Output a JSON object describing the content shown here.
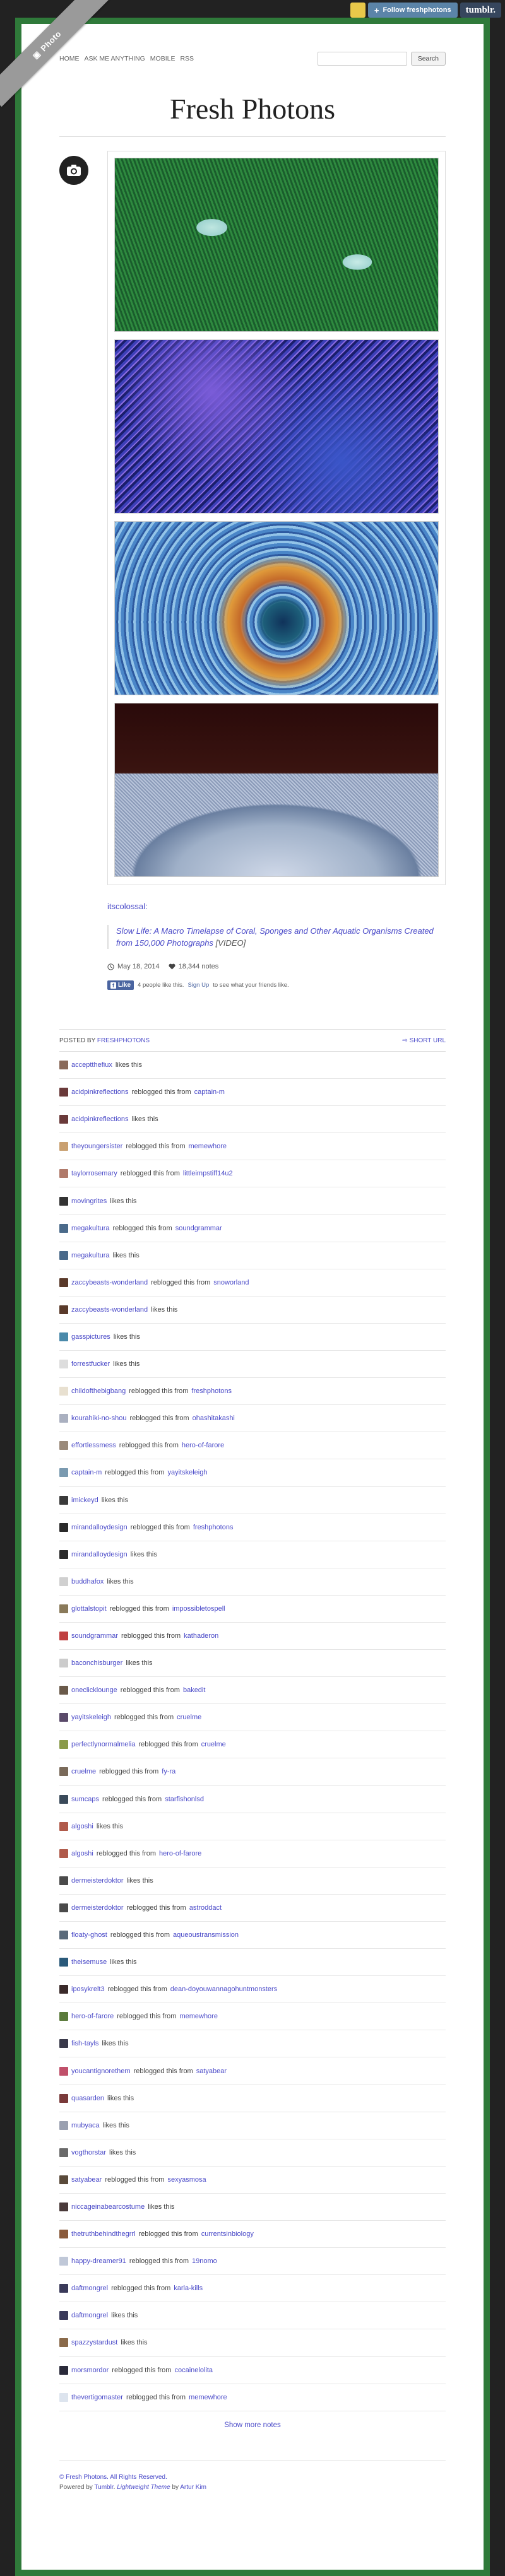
{
  "tumblr_controls": {
    "follow_label": "Follow freshphotons",
    "brand": "tumblr."
  },
  "ribbon": {
    "label": "Photo"
  },
  "nav": {
    "links": [
      "HOME",
      "ASK ME ANYTHING",
      "MOBILE",
      "RSS"
    ],
    "search_placeholder": "",
    "search_button": "Search"
  },
  "site_title": "Fresh Photons",
  "post": {
    "source": "itscolossal:",
    "quote_link": "Slow Life: A Macro Timelapse of Coral, Sponges and Other Aquatic Organisms Created from 150,000 Photographs",
    "quote_suffix": "[VIDEO]",
    "date": "May 18, 2014",
    "notes_count": "18,344 notes",
    "fb_like": "Like",
    "fb_text": "4 people like this.",
    "fb_signup": "Sign Up",
    "fb_text2": "to see what your friends like.",
    "posted_by_label": "POSTED BY",
    "posted_by_user": "FRESHPHOTONS",
    "short_url": "SHORT URL"
  },
  "notes": [
    {
      "user": "acceptthefiux",
      "action": "likes this",
      "from": "",
      "color": "#8a6a5a"
    },
    {
      "user": "acidpinkreflections",
      "action": "reblogged this from",
      "from": "captain-m",
      "color": "#6a3a3a"
    },
    {
      "user": "acidpinkreflections",
      "action": "likes this",
      "from": "",
      "color": "#6a3a3a"
    },
    {
      "user": "theyoungersister",
      "action": "reblogged this from",
      "from": "memewhore",
      "color": "#c9a070"
    },
    {
      "user": "taylorrosemary",
      "action": "reblogged this from",
      "from": "littleimpstiff14u2",
      "color": "#b07a6a"
    },
    {
      "user": "movingrites",
      "action": "likes this",
      "from": "",
      "color": "#333"
    },
    {
      "user": "megakultura",
      "action": "reblogged this from",
      "from": "soundgrammar",
      "color": "#4a6a8a"
    },
    {
      "user": "megakultura",
      "action": "likes this",
      "from": "",
      "color": "#4a6a8a"
    },
    {
      "user": "zaccybeasts-wonderland",
      "action": "reblogged this from",
      "from": "snoworland",
      "color": "#5a3a2a"
    },
    {
      "user": "zaccybeasts-wonderland",
      "action": "likes this",
      "from": "",
      "color": "#5a3a2a"
    },
    {
      "user": "gasspictures",
      "action": "likes this",
      "from": "",
      "color": "#4a8aaa"
    },
    {
      "user": "forrestfucker",
      "action": "likes this",
      "from": "",
      "color": "#ddd"
    },
    {
      "user": "childofthebigbang",
      "action": "reblogged this from",
      "from": "freshphotons",
      "color": "#e8e0d0"
    },
    {
      "user": "kourahiki-no-shou",
      "action": "reblogged this from",
      "from": "ohashitakashi",
      "color": "#aab0c0"
    },
    {
      "user": "effortlessmess",
      "action": "reblogged this from",
      "from": "hero-of-farore",
      "color": "#9a8a7a"
    },
    {
      "user": "captain-m",
      "action": "reblogged this from",
      "from": "yayitskeleigh",
      "color": "#7a9ab0"
    },
    {
      "user": "imickeyd",
      "action": "likes this",
      "from": "",
      "color": "#3a3a3a"
    },
    {
      "user": "mirandalloydesign",
      "action": "reblogged this from",
      "from": "freshphotons",
      "color": "#2a2a2a"
    },
    {
      "user": "mirandalloydesign",
      "action": "likes this",
      "from": "",
      "color": "#2a2a2a"
    },
    {
      "user": "buddhafox",
      "action": "likes this",
      "from": "",
      "color": "#d0d0d0"
    },
    {
      "user": "glottalstopit",
      "action": "reblogged this from",
      "from": "impossibletospell",
      "color": "#8a7a5a"
    },
    {
      "user": "soundgrammar",
      "action": "reblogged this from",
      "from": "kathaderon",
      "color": "#c04040"
    },
    {
      "user": "baconchisburger",
      "action": "likes this",
      "from": "",
      "color": "#ccc"
    },
    {
      "user": "oneclicklounge",
      "action": "reblogged this from",
      "from": "bakedit",
      "color": "#6a5a4a"
    },
    {
      "user": "yayitskeleigh",
      "action": "reblogged this from",
      "from": "cruelme",
      "color": "#5a4a6a"
    },
    {
      "user": "perfectlynormalmelia",
      "action": "reblogged this from",
      "from": "cruelme",
      "color": "#8a9a4a"
    },
    {
      "user": "cruelme",
      "action": "reblogged this from",
      "from": "fy-ra",
      "color": "#7a6a5a"
    },
    {
      "user": "sumcaps",
      "action": "reblogged this from",
      "from": "starfishonlsd",
      "color": "#3a4a5a"
    },
    {
      "user": "algoshi",
      "action": "likes this",
      "from": "",
      "color": "#b05a4a"
    },
    {
      "user": "algoshi",
      "action": "reblogged this from",
      "from": "hero-of-farore",
      "color": "#b05a4a"
    },
    {
      "user": "dermeisterdoktor",
      "action": "likes this",
      "from": "",
      "color": "#4a4a4a"
    },
    {
      "user": "dermeisterdoktor",
      "action": "reblogged this from",
      "from": "astroddact",
      "color": "#4a4a4a"
    },
    {
      "user": "floaty-ghost",
      "action": "reblogged this from",
      "from": "aqueoustransmission",
      "color": "#5a6a7a"
    },
    {
      "user": "theisemuse",
      "action": "likes this",
      "from": "",
      "color": "#2a5a7a"
    },
    {
      "user": "iposykrelt3",
      "action": "reblogged this from",
      "from": "dean-doyouwannagohuntmonsters",
      "color": "#3a2a2a"
    },
    {
      "user": "hero-of-farore",
      "action": "reblogged this from",
      "from": "memewhore",
      "color": "#5a7a3a"
    },
    {
      "user": "fish-tayls",
      "action": "likes this",
      "from": "",
      "color": "#3a3a4a"
    },
    {
      "user": "youcantignorethem",
      "action": "reblogged this from",
      "from": "satyabear",
      "color": "#c0506a"
    },
    {
      "user": "quasarden",
      "action": "likes this",
      "from": "",
      "color": "#7a3a3a"
    },
    {
      "user": "mubyaca",
      "action": "likes this",
      "from": "",
      "color": "#9aa0b0"
    },
    {
      "user": "vogthorstar",
      "action": "likes this",
      "from": "",
      "color": "#6a6a6a"
    },
    {
      "user": "satyabear",
      "action": "reblogged this from",
      "from": "sexyasmosa",
      "color": "#5a4a3a"
    },
    {
      "user": "niccageinabearcostume",
      "action": "likes this",
      "from": "",
      "color": "#4a3a3a"
    },
    {
      "user": "thetruthbehindthegrrl",
      "action": "reblogged this from",
      "from": "currentsinbiology",
      "color": "#8a5a3a"
    },
    {
      "user": "happy-dreamer91",
      "action": "reblogged this from",
      "from": "19nomo",
      "color": "#c0c8d8"
    },
    {
      "user": "daftmongrel",
      "action": "reblogged this from",
      "from": "karla-kills",
      "color": "#3a3a5a"
    },
    {
      "user": "daftmongrel",
      "action": "likes this",
      "from": "",
      "color": "#3a3a5a"
    },
    {
      "user": "spazzystardust",
      "action": "likes this",
      "from": "",
      "color": "#8a6a4a"
    },
    {
      "user": "morsmordor",
      "action": "reblogged this from",
      "from": "cocainelolita",
      "color": "#2a2a3a"
    },
    {
      "user": "thevertigomaster",
      "action": "reblogged this from",
      "from": "memewhore",
      "color": "#dde4ee"
    }
  ],
  "show_more": "Show more notes",
  "footer": {
    "copyright": "© Fresh Photons. All Rights Reserved.",
    "powered_prefix": "Powered by",
    "powered_link": "Tumblr",
    "theme_prefix": ".",
    "theme": "Lightweight Theme",
    "by": "by",
    "author": "Artur Kim"
  }
}
